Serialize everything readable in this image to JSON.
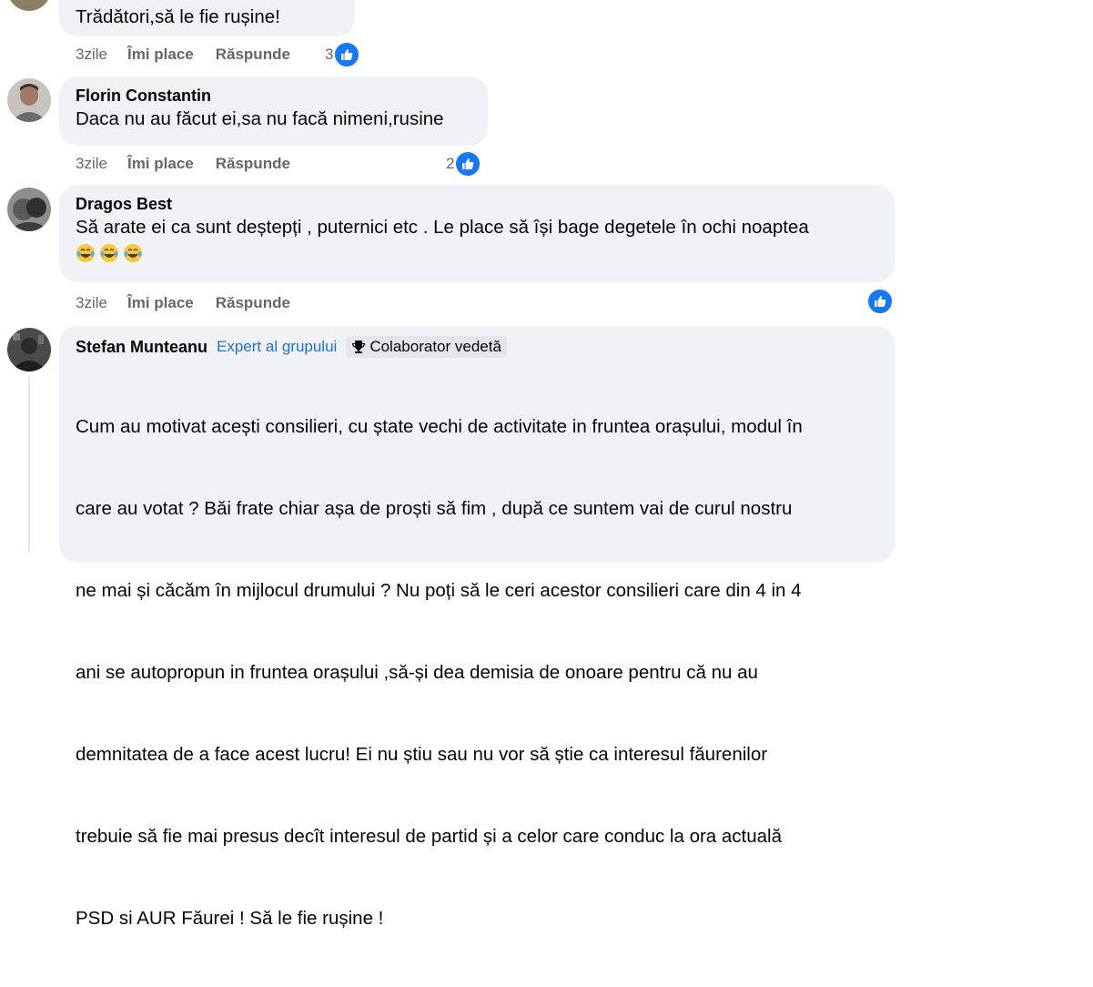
{
  "comments": [
    {
      "text": "Trădători,să le fie rușine!",
      "time": "3zile",
      "like_label": "Îmi place",
      "reply_label": "Răspunde",
      "likes": "3"
    },
    {
      "author": "Florin Constantin",
      "text": "Daca nu au făcut ei,sa nu facă nimeni,rusine",
      "time": "3zile",
      "like_label": "Îmi place",
      "reply_label": "Răspunde",
      "likes": "2"
    },
    {
      "author": "Dragos Best",
      "text": "Să arate ei ca sunt deștepți , puternici etc . Le place să își bage degetele în ochi noaptea",
      "emojis": [
        "laughing-tears-emoji",
        "laughing-tears-emoji",
        "laughing-tears-emoji"
      ],
      "time": "3zile",
      "like_label": "Îmi place",
      "reply_label": "Răspunde",
      "likes": ""
    },
    {
      "author": "Stefan Munteanu",
      "badge_expert": "Expert al grupului",
      "badge_star": "Colaborator vedetă",
      "lines": [
        "Cum au motivat acești consilieri, cu ștate vechi de activitate in fruntea orașului, modul în",
        "care au votat ? Băi frate chiar așa de proști să fim , după ce suntem vai de curul nostru",
        "ne mai și căcăm în mijlocul drumului ? Nu poți să le ceri acestor consilieri care din 4 in 4",
        "ani se autopropun in fruntea orașului ,să-și dea demisia de onoare pentru că nu au",
        "demnitatea de a face acest lucru! Ei nu știu sau nu vor să știe ca interesul făurenilor",
        "trebuie să fie mai presus decît interesul de partid și a celor care conduc la ora actuală",
        "PSD si AUR Făurei ! Să le fie rușine !"
      ]
    }
  ],
  "colors": {
    "bubble": "#f0f2f5",
    "like_blue": "#1877f2",
    "meta_gray": "#65676b",
    "expert_blue": "#216fdb"
  },
  "icons": {
    "like": "thumbs-up-icon",
    "trophy": "trophy-icon"
  }
}
